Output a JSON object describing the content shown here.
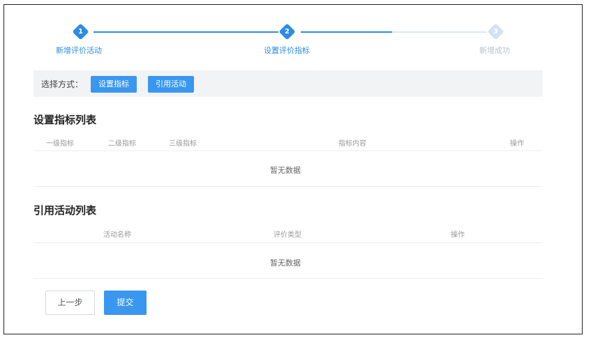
{
  "steps": [
    {
      "num": "1",
      "label": "新增评价活动"
    },
    {
      "num": "2",
      "label": "设置评价指标"
    },
    {
      "num": "3",
      "label": "新增成功"
    }
  ],
  "choose": {
    "label": "选择方式：",
    "set_button": "设置指标",
    "ref_button": "引用活动"
  },
  "indicator_section": {
    "title": "设置指标列表",
    "columns": [
      "一级指标",
      "二级指标",
      "三级指标",
      "指标内容",
      "操作"
    ],
    "empty": "暂无数据"
  },
  "activity_section": {
    "title": "引用活动列表",
    "columns": [
      "活动名称",
      "评价类型",
      "操作"
    ],
    "empty": "暂无数据"
  },
  "footer": {
    "prev": "上一步",
    "submit": "提交"
  },
  "colors": {
    "accent": "#2b8ce5",
    "button": "#3a97f0",
    "inactive": "#cfe3f7"
  }
}
